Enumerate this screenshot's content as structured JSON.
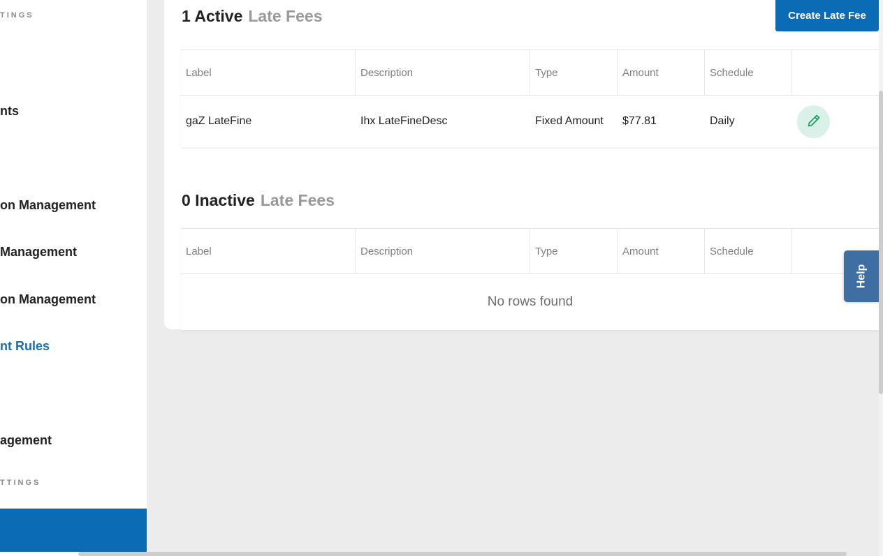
{
  "sidebar": {
    "sections": [
      {
        "label": "TINGS"
      },
      {
        "label": "TTINGS"
      }
    ],
    "items": [
      {
        "label": "nts"
      },
      {
        "label": "on Management"
      },
      {
        "label": "Management"
      },
      {
        "label": "on Management"
      },
      {
        "label": "nt Rules"
      },
      {
        "label": "agement"
      }
    ]
  },
  "active": {
    "count": "1 Active",
    "word": "Late Fees",
    "create_label": "Create Late Fee",
    "columns": [
      "Label",
      "Description",
      "Type",
      "Amount",
      "Schedule",
      ""
    ],
    "rows": [
      {
        "label": "gaZ LateFine",
        "description": "Ihx LateFineDesc",
        "type": "Fixed Amount",
        "amount": "$77.81",
        "schedule": "Daily"
      }
    ]
  },
  "inactive": {
    "count": "0 Inactive",
    "word": "Late Fees",
    "columns": [
      "Label",
      "Description",
      "Type",
      "Amount",
      "Schedule",
      ""
    ],
    "empty_text": "No rows found"
  },
  "help": {
    "label": "Help"
  },
  "colors": {
    "primary": "#0b6bb5",
    "active_nav": "#1a6fb0",
    "edit_bg": "#d9f1e8",
    "edit_icon": "#2e9e6e",
    "help_bg": "#3f6ea3"
  },
  "icons": {
    "edit": "pencil-icon"
  }
}
